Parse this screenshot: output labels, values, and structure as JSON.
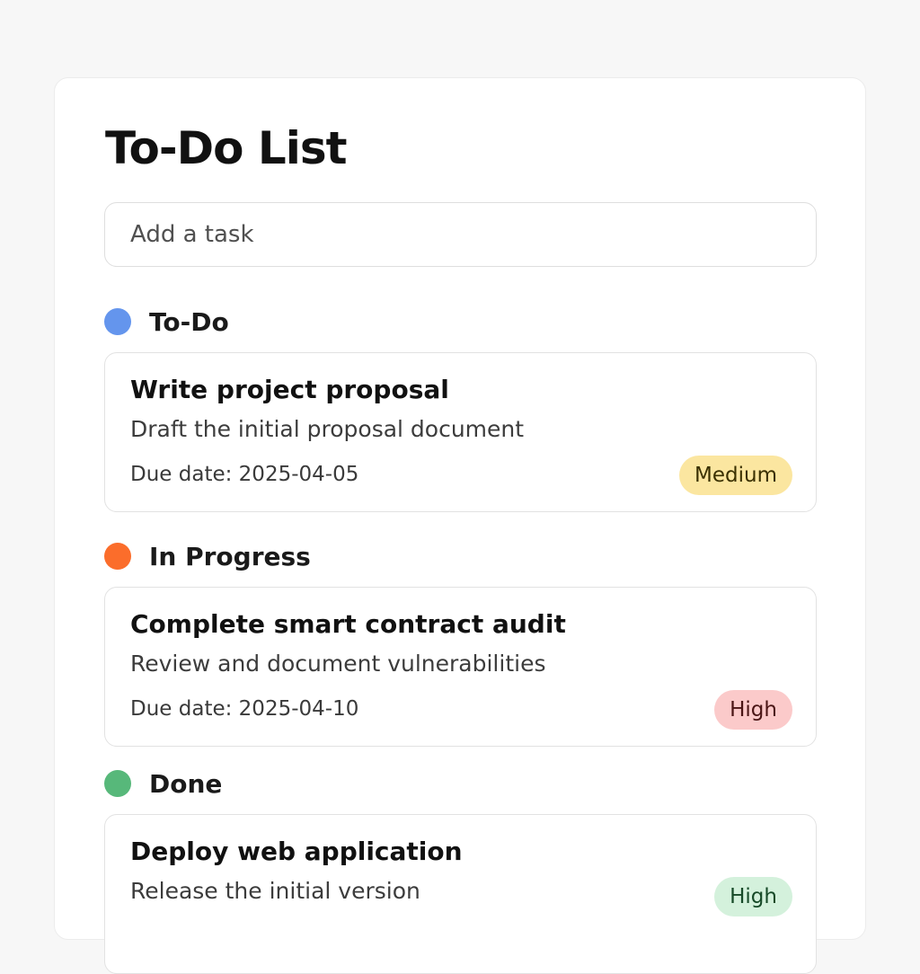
{
  "page_title": "To-Do List",
  "add_task": {
    "placeholder": "Add a task",
    "value": ""
  },
  "sections": [
    {
      "label": "To-Do",
      "color": "#6495ed",
      "task": {
        "title": "Write project proposal",
        "description": "Draft the initial proposal document",
        "due": "Due date: 2025-04-05",
        "priority": "Medium",
        "priority_bg": "#fbe6a0",
        "priority_fg": "#3a3000"
      }
    },
    {
      "label": "In Progress",
      "color": "#fb6d2b",
      "task": {
        "title": "Complete smart contract audit",
        "description": "Review and document vulnerabilities",
        "due": "Due date: 2025-04-10",
        "priority": "High",
        "priority_bg": "#fbcaca",
        "priority_fg": "#4a1515"
      }
    },
    {
      "label": "Done",
      "color": "#57b87a",
      "task": {
        "title": "Deploy web application",
        "description": "Release the initial version",
        "due": "",
        "priority": "High",
        "priority_bg": "#d4f1dc",
        "priority_fg": "#174a28"
      }
    }
  ]
}
